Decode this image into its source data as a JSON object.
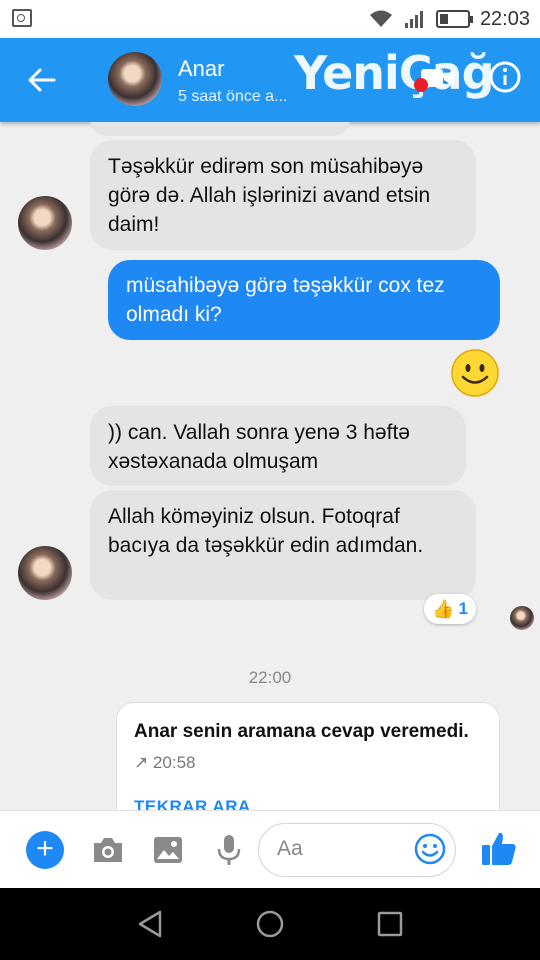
{
  "status": {
    "time": "22:03"
  },
  "header": {
    "contact_name": "Anar",
    "subtitle": "5 saat önce a...",
    "watermark": "YeniÇağ"
  },
  "messages": [
    {
      "side": "in",
      "text": "Təşəkkür edirəm son müsahibəyə görə də. Allah işlərinizi avand etsin daim!"
    },
    {
      "side": "out",
      "text": "müsahibəyə görə təşəkkür cox tez olmadı ki?"
    },
    {
      "side": "out",
      "emoji": "smiley-emoji"
    },
    {
      "side": "in",
      "text": ")) can. Vallah sonra yenə 3 həftə xəstəxanada olmuşam"
    },
    {
      "side": "in",
      "text": "Allah köməyiniz olsun. Fotoqraf bacıya da təşəkkür edin adımdan."
    }
  ],
  "reaction": {
    "icon": "thumbs-up-icon",
    "count": "1"
  },
  "divider_time": "22:00",
  "call_card": {
    "title": "Anar senin aramana cevap veremedi.",
    "time": "↗ 20:58",
    "action": "TEKRAR ARA"
  },
  "compose": {
    "placeholder": "Aa"
  },
  "colors": {
    "accent": "#2196f3",
    "bubble_out": "#1e88f5",
    "bubble_in": "#e4e4e4"
  }
}
